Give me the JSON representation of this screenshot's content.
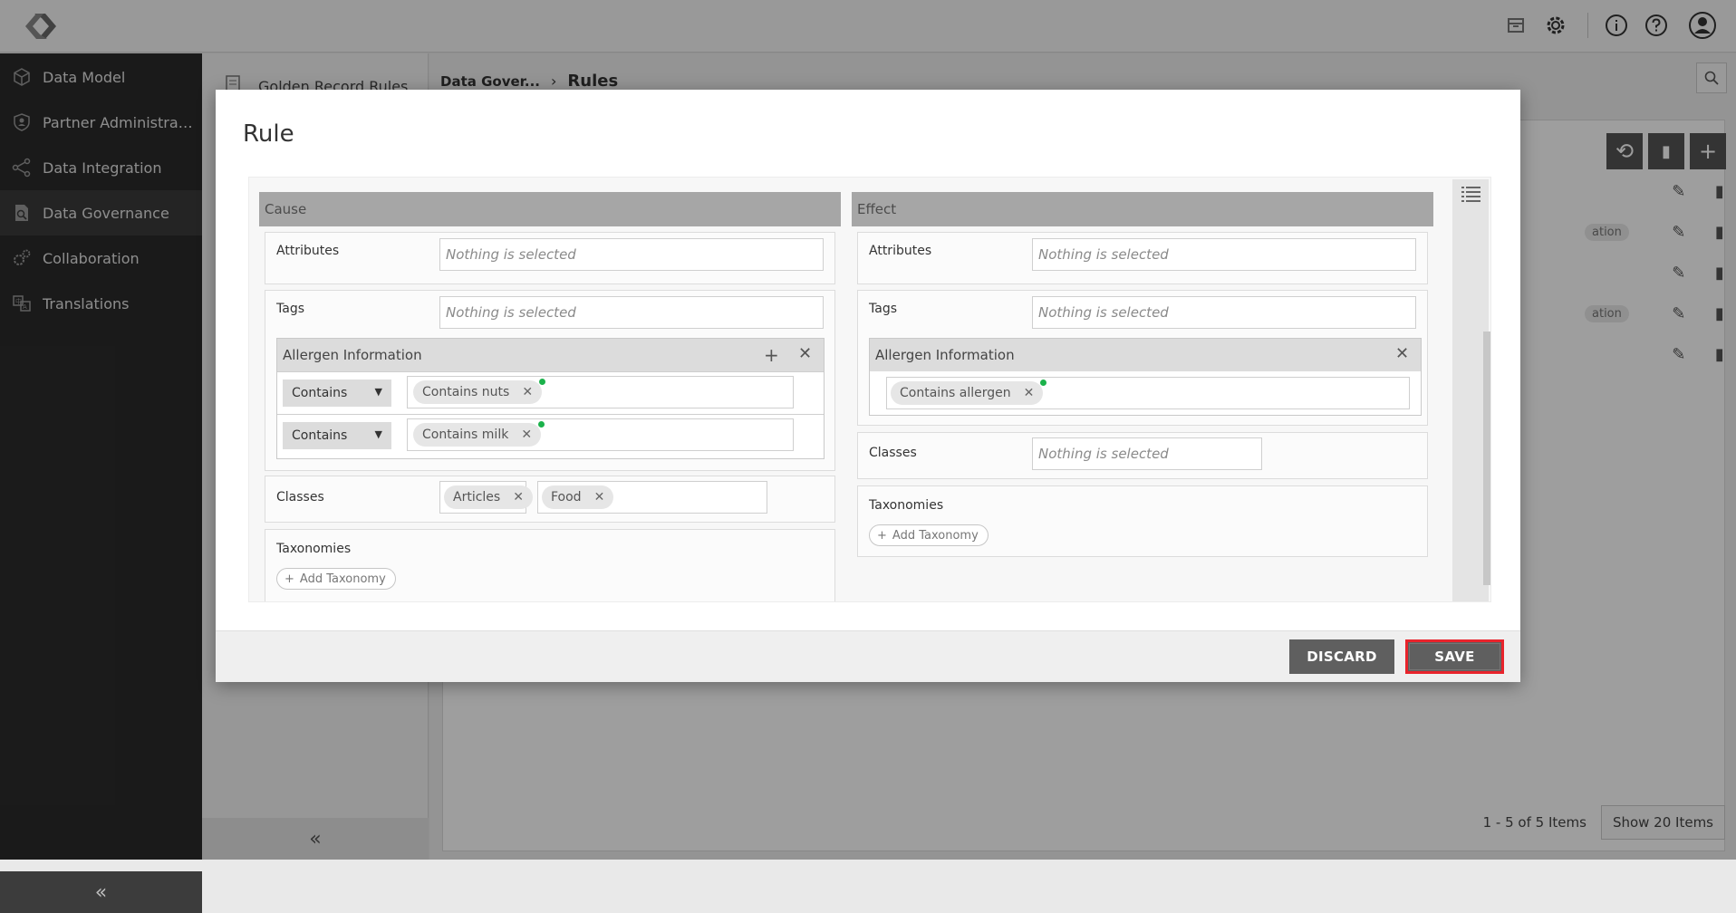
{
  "app": {
    "nav": [
      {
        "label": "Data Model",
        "icon": "cube-icon"
      },
      {
        "label": "Partner Administration",
        "icon": "shield-user-icon"
      },
      {
        "label": "Data Integration",
        "icon": "share-nodes-icon"
      },
      {
        "label": "Data Governance",
        "icon": "document-search-icon"
      },
      {
        "label": "Collaboration",
        "icon": "gears-icon"
      },
      {
        "label": "Translations",
        "icon": "translate-icon"
      }
    ],
    "collapse_glyph": "«",
    "subnav_item": "Golden Record Rules",
    "breadcrumb": {
      "parent": "Data Gover...",
      "separator": "›",
      "current": "Rules"
    },
    "row_tags": [
      "ation",
      "ation"
    ],
    "pager": {
      "range": "1 - 5 of 5 Items",
      "show_button": "Show 20 Items"
    }
  },
  "modal": {
    "title": "Rule",
    "cause": {
      "header": "Cause",
      "attributes_label": "Attributes",
      "attributes_placeholder": "Nothing is selected",
      "tags_label": "Tags",
      "tags_placeholder": "Nothing is selected",
      "allergen": {
        "title": "Allergen Information",
        "rows": [
          {
            "operator": "Contains",
            "value": "Contains nuts"
          },
          {
            "operator": "Contains",
            "value": "Contains milk"
          }
        ]
      },
      "classes_label": "Classes",
      "classes": [
        "Articles",
        "Food"
      ],
      "taxonomies_label": "Taxonomies",
      "add_taxonomy": "Add Taxonomy"
    },
    "effect": {
      "header": "Effect",
      "attributes_label": "Attributes",
      "attributes_placeholder": "Nothing is selected",
      "tags_label": "Tags",
      "tags_placeholder": "Nothing is selected",
      "allergen": {
        "title": "Allergen Information",
        "value": "Contains allergen"
      },
      "classes_label": "Classes",
      "classes_placeholder": "Nothing is selected",
      "taxonomies_label": "Taxonomies",
      "add_taxonomy": "Add Taxonomy"
    },
    "buttons": {
      "discard": "DISCARD",
      "save": "SAVE"
    },
    "colors": {
      "save_highlight": "#e8242c",
      "chip_dot": "#1bb24b",
      "section_header": "#a6a6a6"
    }
  }
}
